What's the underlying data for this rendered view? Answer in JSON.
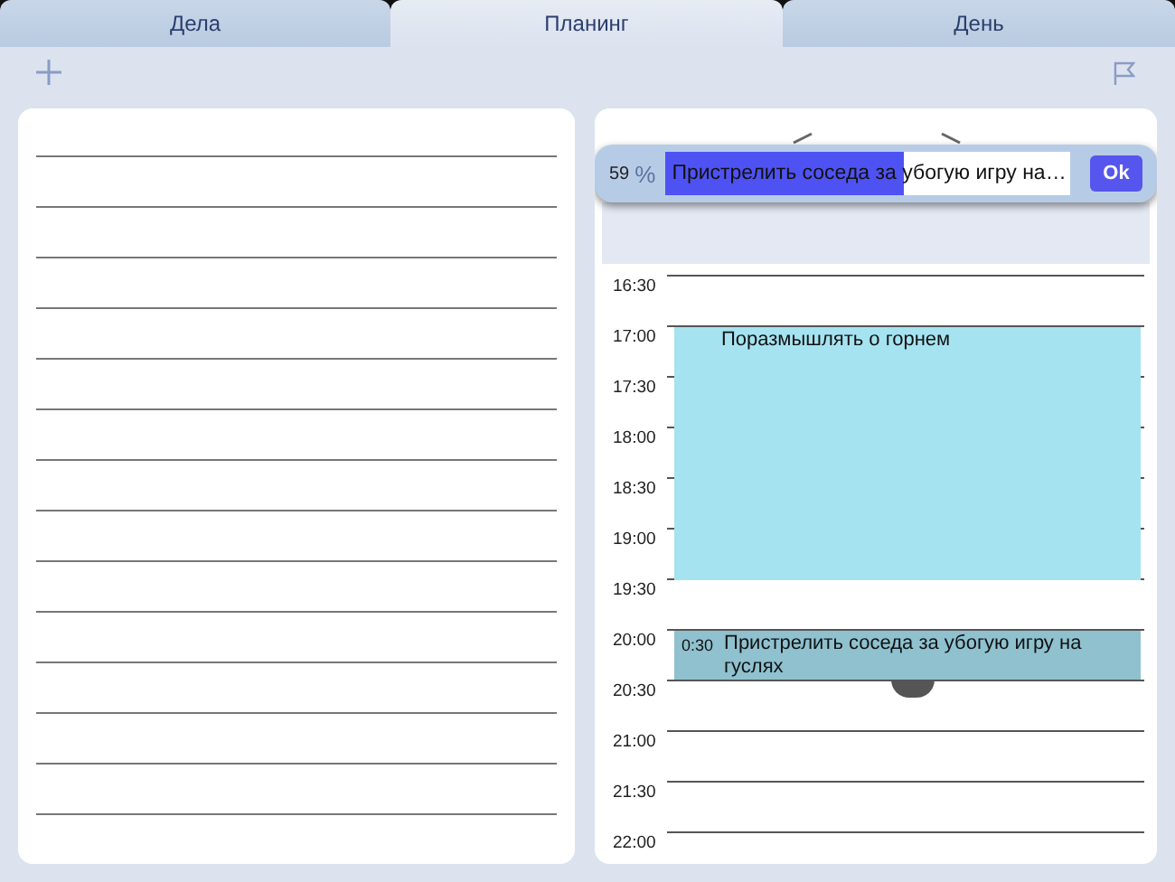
{
  "tabs": [
    {
      "label": "Дела",
      "selected": false
    },
    {
      "label": "Планинг",
      "selected": true
    },
    {
      "label": "День",
      "selected": false
    }
  ],
  "task_editor": {
    "percent": "59",
    "percent_sign": "%",
    "level": 0.59,
    "value": "Пристрелить соседа за убогую игру на…",
    "ok_button": "Ok"
  },
  "time_slots": [
    {
      "time": "16:30",
      "occupied": false
    },
    {
      "time": "17:00",
      "occupied": true,
      "event": {
        "title": "Поразмышлять о горнем",
        "selected": false
      }
    },
    {
      "time": "17:30",
      "occupied": true
    },
    {
      "time": "18:00",
      "occupied": true
    },
    {
      "time": "18:30",
      "occupied": true
    },
    {
      "time": "19:00",
      "occupied": true
    },
    {
      "time": "19:30",
      "occupied": false
    },
    {
      "time": "20:00",
      "occupied": true,
      "event": {
        "title": "Пристрелить соседа за убогую игру на гуслях",
        "duration": "0:30",
        "selected": true
      }
    },
    {
      "time": "20:30",
      "occupied": false
    },
    {
      "time": "21:00",
      "occupied": false
    },
    {
      "time": "21:30",
      "occupied": false
    },
    {
      "time": "22:00",
      "occupied": false
    }
  ]
}
